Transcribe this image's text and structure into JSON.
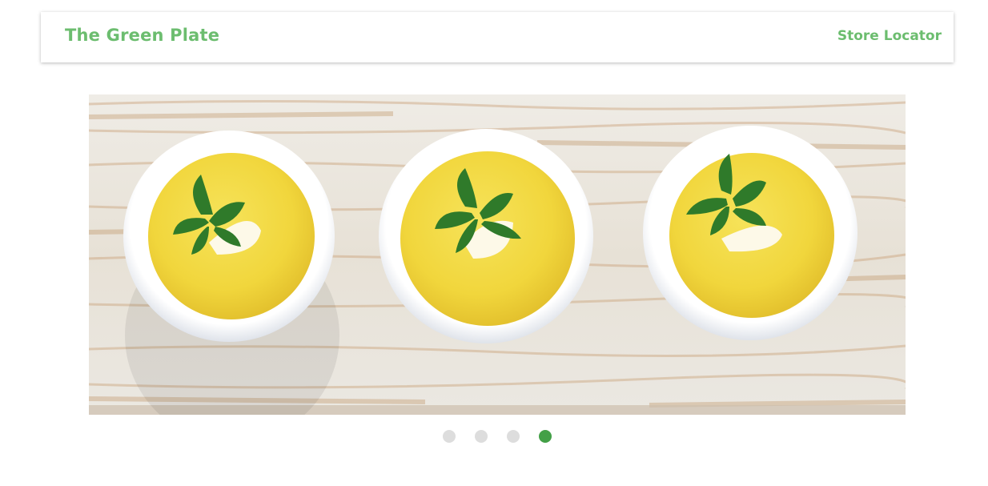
{
  "navbar": {
    "brand": "The Green Plate",
    "link_store_locator": "Store Locator"
  },
  "carousel": {
    "slide_count": 4,
    "active_index": 3,
    "colors": {
      "dot_inactive": "#dddddd",
      "dot_active": "#43a047"
    }
  },
  "colors": {
    "brand": "#6cbd6f"
  }
}
